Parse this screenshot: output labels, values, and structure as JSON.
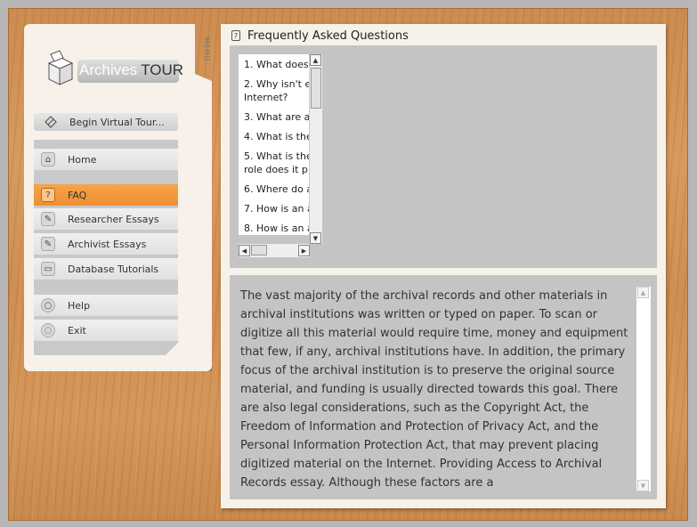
{
  "menu": {
    "tab_label": "MENU",
    "logo": {
      "archives": "Archives",
      "tour": "TOUR"
    },
    "begin_tour": "Begin Virtual Tour...",
    "items": [
      {
        "label": "Home",
        "icon": "home-icon"
      },
      {
        "label": "FAQ",
        "icon": "faq-icon",
        "active": true
      },
      {
        "label": "Researcher Essays",
        "icon": "essay-icon"
      },
      {
        "label": "Archivist Essays",
        "icon": "essay-icon"
      },
      {
        "label": "Database Tutorials",
        "icon": "monitor-icon"
      },
      {
        "label": "Help",
        "icon": "help-icon"
      },
      {
        "label": "Exit",
        "icon": "exit-icon"
      }
    ]
  },
  "faq": {
    "title": "Frequently Asked Questions",
    "questions": [
      "1. What does",
      "2. Why isn't e Internet?",
      "3. What are a",
      "4. What is the",
      "5. What is the role does it p",
      "6. Where do a",
      "7. How is an a",
      "8. How is an a"
    ],
    "answer": "The vast majority of the archival records and other materials in archival institutions was written or typed on paper.  To scan or digitize all this material would require time, money and equipment that few, if any, archival institutions have.  In addition, the primary focus of the archival institution is to preserve the original source material, and funding is usually directed towards this goal.  There are also legal considerations, such as the Copyright Act, the Freedom of Information and Protection of Privacy Act, and the Personal Information Protection Act, that may prevent placing digitized material on the Internet.  Providing Access to Archival Records essay.  Although these factors are a"
  },
  "colors": {
    "active": "#f29a3c",
    "wood": "#d4955a"
  }
}
